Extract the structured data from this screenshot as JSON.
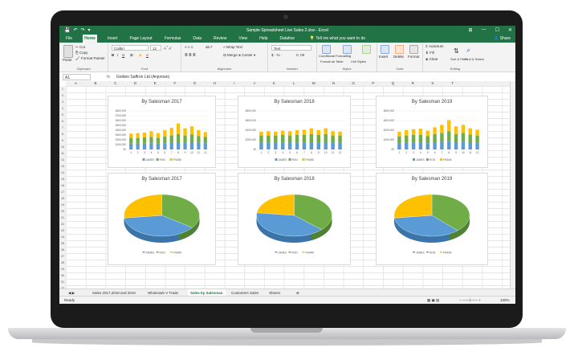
{
  "window": {
    "title": "Sample Spreadsheet Live Sales 2.xlsx - Excel",
    "controls": [
      "⊞",
      "—",
      "☐",
      "✕"
    ]
  },
  "qat": {
    "save": "💾",
    "undo": "↶",
    "redo": "↷",
    "more": "▾"
  },
  "tabs": [
    "File",
    "Home",
    "Insert",
    "Page Layout",
    "Formulas",
    "Data",
    "Review",
    "View",
    "Help",
    "Datafow"
  ],
  "active_tab": "Home",
  "tell_me": "Tell me what you want to do",
  "share": "Share",
  "ribbon": {
    "clipboard": {
      "paste": "Paste",
      "cut": "Cut",
      "copy": "Copy",
      "format_painter": "Format Painter",
      "label": "Clipboard"
    },
    "font": {
      "name": "Calibri",
      "size": "12",
      "label": "Font"
    },
    "alignment": {
      "wrap": "Wrap Text",
      "merge": "Merge & Center",
      "label": "Alignment"
    },
    "number": {
      "format": "Text",
      "label": "Number"
    },
    "styles": {
      "cond": "Conditional Formatting",
      "table": "Format as Table",
      "cell": "Cell Styles",
      "label": "Styles"
    },
    "cells": {
      "insert": "Insert",
      "delete": "Delete",
      "format": "Format",
      "label": "Cells"
    },
    "editing": {
      "autosum": "AutoSum",
      "fill": "Fill",
      "clear": "Clear",
      "sort": "Sort & Filter",
      "find": "Find & Select",
      "label": "Editing"
    }
  },
  "formula_bar": {
    "cell_ref": "A1",
    "fx": "fx",
    "content": "Golden Saffron Ltd (Anjoman)"
  },
  "columns": [
    "A",
    "B",
    "C",
    "D",
    "E",
    "F",
    "G",
    "H",
    "I",
    "J",
    "K",
    "L",
    "M",
    "N",
    "O",
    "P",
    "Q",
    "R",
    "S",
    "T"
  ],
  "rows": [
    "1",
    "2",
    "3",
    "4",
    "5",
    "6",
    "7",
    "8",
    "9",
    "10",
    "11",
    "12",
    "13",
    "14",
    "15",
    "16",
    "17",
    "18",
    "19",
    "20",
    "21",
    "22",
    "23",
    "24",
    "25",
    "26",
    "27",
    "28",
    "29",
    "30",
    "31",
    "32"
  ],
  "sheet_tabs": [
    "Sales 2017,2018 and 2019",
    "Wholesale V Trade",
    "Sales by Salesman",
    "Customers Sales",
    "Sheet1"
  ],
  "active_sheet": "Sales by Salesman",
  "status": {
    "ready": "Ready",
    "zoom": "100%"
  },
  "colors": {
    "excel_green": "#217346",
    "james": "#5b9bd5",
    "ron": "#70ad47",
    "frank": "#ffc000"
  },
  "chart_data": [
    {
      "type": "bar",
      "title": "By Salesman 2017",
      "stacked": true,
      "categories": [
        "1",
        "2",
        "3",
        "4",
        "5",
        "6",
        "7",
        "8",
        "9",
        "10",
        "11",
        "12"
      ],
      "y_ticks": [
        "£800,000",
        "£700,000",
        "£600,000",
        "£500,000",
        "£400,000",
        "£300,000",
        "£200,000",
        "£100,000",
        "£0"
      ],
      "ylim": [
        0,
        800000
      ],
      "series": [
        {
          "name": "JAMES",
          "values": [
            120000,
            120000,
            120000,
            130000,
            120000,
            130000,
            140000,
            150000,
            140000,
            150000,
            140000,
            130000
          ]
        },
        {
          "name": "RON",
          "values": [
            120000,
            120000,
            130000,
            130000,
            120000,
            140000,
            150000,
            170000,
            150000,
            160000,
            140000,
            130000
          ]
        },
        {
          "name": "FRANK",
          "values": [
            90000,
            100000,
            100000,
            120000,
            100000,
            130000,
            160000,
            220000,
            150000,
            170000,
            120000,
            100000
          ]
        }
      ]
    },
    {
      "type": "bar",
      "title": "By Salesman 2018",
      "stacked": true,
      "categories": [
        "1",
        "2",
        "3",
        "4",
        "5",
        "6",
        "7",
        "8",
        "9",
        "10",
        "11",
        "12"
      ],
      "y_ticks": [
        "£800,000",
        "£600,000",
        "£400,000",
        "£200,000",
        "£0"
      ],
      "ylim": [
        0,
        800000
      ],
      "series": [
        {
          "name": "JAMES",
          "values": [
            140000,
            140000,
            140000,
            140000,
            140000,
            140000,
            140000,
            150000,
            140000,
            150000,
            140000,
            140000
          ]
        },
        {
          "name": "RON",
          "values": [
            150000,
            150000,
            150000,
            160000,
            150000,
            160000,
            160000,
            170000,
            160000,
            170000,
            150000,
            150000
          ]
        },
        {
          "name": "FRANK",
          "values": [
            80000,
            90000,
            80000,
            90000,
            90000,
            100000,
            110000,
            120000,
            100000,
            120000,
            90000,
            80000
          ]
        }
      ]
    },
    {
      "type": "bar",
      "title": "By Salesman 2019",
      "stacked": true,
      "categories": [
        "1",
        "2",
        "3",
        "4",
        "5",
        "6",
        "7",
        "8",
        "9",
        "10",
        "11",
        "12"
      ],
      "y_ticks": [
        "£800,000",
        "£600,000",
        "£400,000",
        "£200,000",
        "£0"
      ],
      "ylim": [
        0,
        800000
      ],
      "series": [
        {
          "name": "JAMES",
          "values": [
            130000,
            140000,
            140000,
            140000,
            130000,
            150000,
            160000,
            180000,
            150000,
            160000,
            150000,
            140000
          ]
        },
        {
          "name": "RON",
          "values": [
            140000,
            150000,
            160000,
            160000,
            150000,
            170000,
            180000,
            200000,
            170000,
            180000,
            160000,
            150000
          ]
        },
        {
          "name": "FRANK",
          "values": [
            100000,
            110000,
            120000,
            130000,
            110000,
            140000,
            170000,
            230000,
            160000,
            170000,
            130000,
            120000
          ]
        }
      ]
    },
    {
      "type": "pie",
      "title": "By Salesman 2017",
      "categories": [
        "JAMES",
        "RON",
        "FRANK"
      ],
      "values": [
        38,
        35,
        27
      ]
    },
    {
      "type": "pie",
      "title": "By Salesman 2018",
      "categories": [
        "JAMES",
        "RON",
        "FRANK"
      ],
      "values": [
        40,
        37,
        23
      ]
    },
    {
      "type": "pie",
      "title": "By Salesman 2019",
      "categories": [
        "JAMES",
        "RON",
        "FRANK"
      ],
      "values": [
        35,
        38,
        27
      ]
    }
  ]
}
